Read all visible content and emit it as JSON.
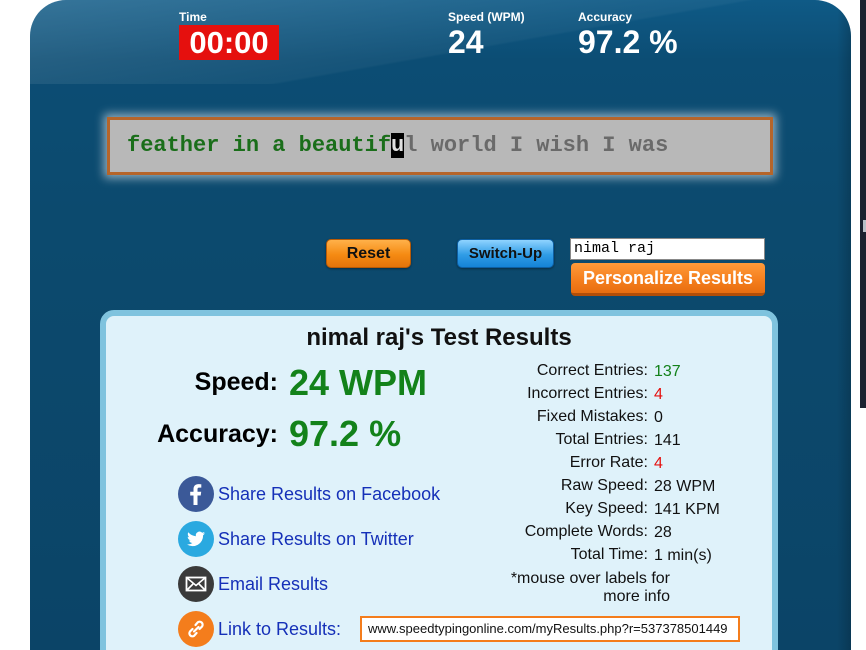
{
  "header": {
    "time_label": "Time",
    "time_value": "00:00",
    "speed_label": "Speed (WPM)",
    "speed_value": "24",
    "accuracy_label": "Accuracy",
    "accuracy_value": "97.2 %"
  },
  "typing": {
    "typed": "feather in a beautif",
    "current": "u",
    "remaining": "l world I wish I was"
  },
  "controls": {
    "reset_label": "Reset",
    "switch_label": "Switch-Up",
    "name_value": "nimal raj",
    "personalize_label": "Personalize Results"
  },
  "results": {
    "title": "nimal raj's Test Results",
    "speed_label": "Speed:",
    "speed_value": "24 WPM",
    "accuracy_label": "Accuracy:",
    "accuracy_value": "97.2 %",
    "share_facebook": "Share Results on Facebook",
    "share_twitter": "Share Results on Twitter",
    "email": "Email Results",
    "link_label": "Link to Results:",
    "link_url": "www.speedtypingonline.com/myResults.php?r=537378501449",
    "stats": [
      {
        "label": "Correct Entries:",
        "value": "137"
      },
      {
        "label": "Incorrect Entries:",
        "value": "4"
      },
      {
        "label": "Fixed Mistakes:",
        "value": "0"
      },
      {
        "label": "Total Entries:",
        "value": "141"
      },
      {
        "label": "Error Rate:",
        "value": "4"
      },
      {
        "label": "Raw Speed:",
        "value": "28 WPM"
      },
      {
        "label": "Key Speed:",
        "value": "141 KPM"
      },
      {
        "label": "Complete Words:",
        "value": "28"
      },
      {
        "label": "Total Time:",
        "value": "1 min(s)"
      }
    ],
    "note_line1": "*mouse over labels for",
    "note_line2": "more info"
  },
  "icons": [
    "facebook-icon",
    "twitter-icon",
    "email-icon",
    "link-icon"
  ],
  "colors": {
    "panel": "#0c4a6e",
    "timer": "#e5100e",
    "good": "#13821a",
    "bad": "#e5100e",
    "accent_orange": "#f47d1c",
    "accent_blue": "#2f9ce6",
    "link": "#1530b8"
  }
}
